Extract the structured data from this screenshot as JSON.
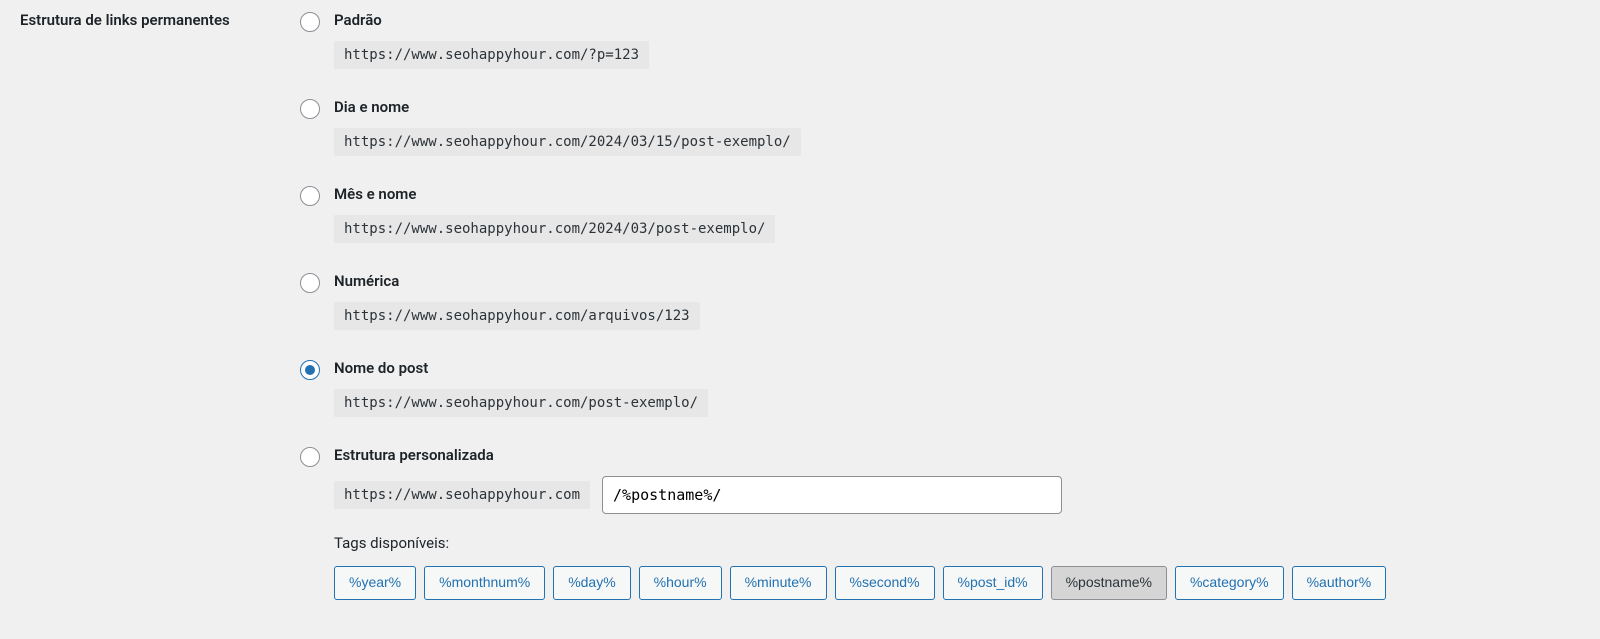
{
  "section_label": "Estrutura de links permanentes",
  "options": [
    {
      "id": "plain",
      "label": "Padrão",
      "example": "https://www.seohappyhour.com/?p=123",
      "selected": false
    },
    {
      "id": "dayname",
      "label": "Dia e nome",
      "example": "https://www.seohappyhour.com/2024/03/15/post-exemplo/",
      "selected": false
    },
    {
      "id": "monthname",
      "label": "Mês e nome",
      "example": "https://www.seohappyhour.com/2024/03/post-exemplo/",
      "selected": false
    },
    {
      "id": "numeric",
      "label": "Numérica",
      "example": "https://www.seohappyhour.com/arquivos/123",
      "selected": false
    },
    {
      "id": "postname",
      "label": "Nome do post",
      "example": "https://www.seohappyhour.com/post-exemplo/",
      "selected": true
    },
    {
      "id": "custom",
      "label": "Estrutura personalizada",
      "base": "https://www.seohappyhour.com",
      "value": "/%postname%/",
      "selected": false
    }
  ],
  "tags_label": "Tags disponíveis:",
  "tags": [
    {
      "text": "%year%",
      "selected": false
    },
    {
      "text": "%monthnum%",
      "selected": false
    },
    {
      "text": "%day%",
      "selected": false
    },
    {
      "text": "%hour%",
      "selected": false
    },
    {
      "text": "%minute%",
      "selected": false
    },
    {
      "text": "%second%",
      "selected": false
    },
    {
      "text": "%post_id%",
      "selected": false
    },
    {
      "text": "%postname%",
      "selected": true
    },
    {
      "text": "%category%",
      "selected": false
    },
    {
      "text": "%author%",
      "selected": false
    }
  ]
}
